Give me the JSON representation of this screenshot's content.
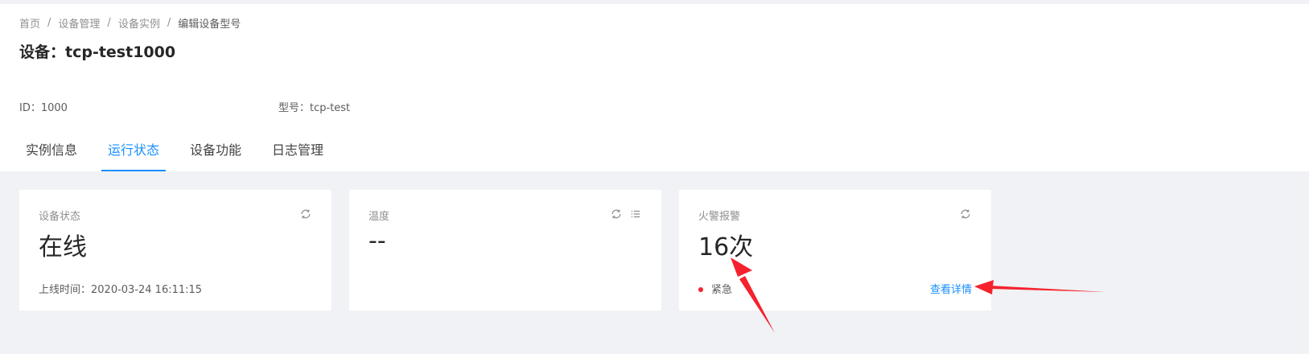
{
  "breadcrumb": {
    "items": [
      "首页",
      "设备管理",
      "设备实例",
      "编辑设备型号"
    ],
    "separator": "/"
  },
  "page": {
    "title": "设备：tcp-test1000"
  },
  "descriptions": {
    "id": "ID：1000",
    "model": "型号：tcp-test"
  },
  "tabs": [
    {
      "label": "实例信息",
      "active": false
    },
    {
      "label": "运行状态",
      "active": true
    },
    {
      "label": "设备功能",
      "active": false
    },
    {
      "label": "日志管理",
      "active": false
    }
  ],
  "cards": {
    "device_status": {
      "title": "设备状态",
      "value": "在线",
      "footer": "上线时间：2020-03-24 16:11:15",
      "icons": [
        "refresh-icon"
      ]
    },
    "temperature": {
      "title": "温度",
      "value": "--",
      "icons": [
        "refresh-icon",
        "list-icon"
      ]
    },
    "fire_alarm": {
      "title": "火警报警",
      "value": "16次",
      "level": "紧急",
      "link": "查看详情",
      "icons": [
        "refresh-icon"
      ]
    }
  },
  "colors": {
    "primary": "#1890ff",
    "danger": "#f5222d",
    "annotation": "#f5222d",
    "background": "#f0f2f5"
  }
}
